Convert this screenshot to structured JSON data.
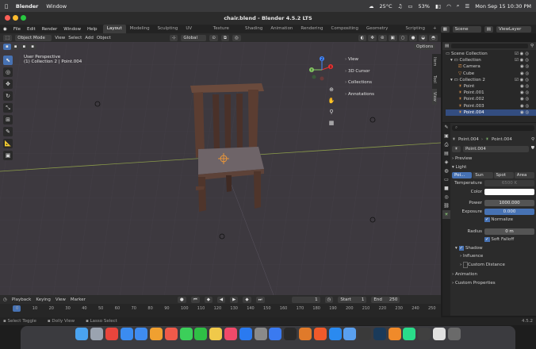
{
  "macos": {
    "menus": [
      "Blender",
      "Window"
    ],
    "temperature": "25°C",
    "battery": "53%",
    "datetime": "Mon Sep 15  10:30 PM"
  },
  "window": {
    "title": "chair.blend - Blender 4.5.2 LTS"
  },
  "topbar": {
    "menus": [
      "File",
      "Edit",
      "Render",
      "Window",
      "Help"
    ],
    "workspaces": [
      "Layout",
      "Modeling",
      "Sculpting",
      "UV Editing",
      "Texture Paint",
      "Shading",
      "Animation",
      "Rendering",
      "Compositing",
      "Geometry Nodes",
      "Scripting"
    ],
    "add_tab": "+",
    "scene": "Scene",
    "view_layer": "ViewLayer"
  },
  "header": {
    "mode": "Object Mode",
    "menus": [
      "View",
      "Select",
      "Add",
      "Object"
    ],
    "transform_orientation": "Global",
    "options": "Options"
  },
  "viewport": {
    "perspective": "User Perspective",
    "collection_info": "(1) Collection 2 | Point.004",
    "overlay_items": [
      "View",
      "3D Cursor",
      "Collections",
      "Annotations"
    ],
    "sidebar_tabs": [
      "Item",
      "Tool",
      "View"
    ],
    "gizmo_axes": [
      "X",
      "Y",
      "Z"
    ]
  },
  "outliner": {
    "root": "Scene Collection",
    "items": [
      {
        "label": "Collection",
        "depth": 1
      },
      {
        "label": "Camera",
        "depth": 2
      },
      {
        "label": "Cube",
        "depth": 2
      },
      {
        "label": "Collection 2",
        "depth": 1
      },
      {
        "label": "Point",
        "depth": 2
      },
      {
        "label": "Point.001",
        "depth": 2
      },
      {
        "label": "Point.002",
        "depth": 2
      },
      {
        "label": "Point.003",
        "depth": 2
      },
      {
        "label": "Point.004",
        "depth": 2
      }
    ]
  },
  "properties": {
    "search_placeholder": "",
    "breadcrumb": [
      "Point.004",
      "Point.004"
    ],
    "datablock": "Point.004",
    "preview": "Preview",
    "light": "Light",
    "light_types": [
      "Poi...",
      "Sun",
      "Spot",
      "Area"
    ],
    "temperature_label": "Temperature",
    "temperature_value": "6500 K",
    "color_label": "Color",
    "color_hex": "#ffffff",
    "power_label": "Power",
    "power_value": "1000.000",
    "exposure_label": "Exposure",
    "exposure_value": "0.000",
    "normalize": "Normalize",
    "radius_label": "Radius",
    "radius_value": "0 m",
    "soft_falloff": "Soft Falloff",
    "shadow": "Shadow",
    "influence": "Influence",
    "custom_distance": "Custom Distance",
    "animation": "Animation",
    "custom_properties": "Custom Properties"
  },
  "timeline": {
    "menus": [
      "Playback",
      "Keying",
      "View",
      "Marker"
    ],
    "current_frame": "1",
    "start_label": "Start",
    "start_value": "1",
    "end_label": "End",
    "end_value": "250",
    "ticks": [
      "0",
      "10",
      "20",
      "30",
      "40",
      "50",
      "60",
      "70",
      "80",
      "90",
      "100",
      "110",
      "120",
      "130",
      "140",
      "150",
      "160",
      "170",
      "180",
      "190",
      "200",
      "210",
      "220",
      "230",
      "240",
      "250"
    ]
  },
  "statusbar": {
    "items": [
      "Select Toggle",
      "Dolly View",
      "Lasso Select"
    ],
    "version": "4.5.2"
  },
  "dock": {
    "apps": [
      "Finder",
      "Launchpad",
      "Chrome",
      "Safari",
      "Mail",
      "Photos",
      "Calendar",
      "Messages",
      "WhatsApp",
      "Notes",
      "Music",
      "App Store",
      "Settings",
      "Xcode",
      "Terminal",
      "Blender",
      "Brave",
      "VS Code",
      "Preview",
      "Activity Monitor",
      "Steam",
      "Sublime",
      "Pycharm",
      "Mac Mini",
      "XnPaint",
      "Trash"
    ]
  }
}
